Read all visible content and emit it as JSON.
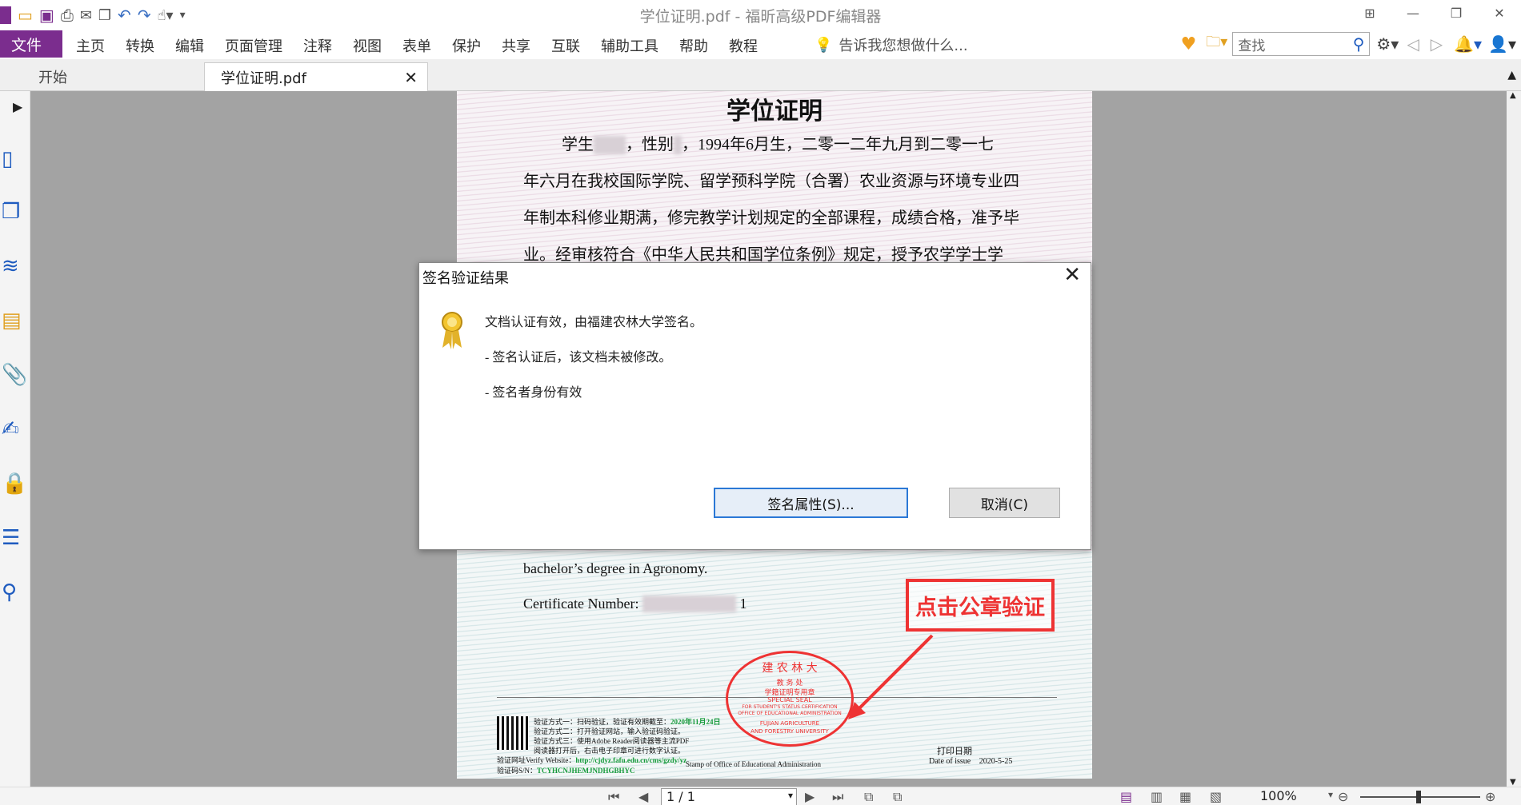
{
  "window": {
    "title": "学位证明.pdf - 福昕高级PDF编辑器"
  },
  "menu": {
    "file": "文件",
    "items": [
      "主页",
      "转换",
      "编辑",
      "页面管理",
      "注释",
      "视图",
      "表单",
      "保护",
      "共享",
      "互联",
      "辅助工具",
      "帮助",
      "教程"
    ],
    "tell_me": "告诉我您想做什么...",
    "search_placeholder": "查找"
  },
  "tabs": [
    {
      "label": "开始"
    },
    {
      "label": "学位证明.pdf"
    }
  ],
  "document": {
    "title": "学位证明",
    "lines": [
      "，性别",
      "，1994年6月生，二零一二年九月到二零一七",
      "年六月在我校国际学院、留学预科学院（合署）农业资源与环境专业四",
      "年制本科修业期满，修完教学计划规定的全部课程，成绩合格，准予毕",
      "业。经审核符合《中华人民共和国学位条例》规定，授予农学学士学"
    ],
    "student_prefix": "学生",
    "english_line": "bachelor’s degree in Agronomy.",
    "cert_label": "Certificate Number:",
    "cert_tail": "1",
    "footer": {
      "v1": "验证方式一：扫码验证，验证有效期截至：",
      "v1_date": "2020年11月24日",
      "v2": "验证方式二：打开验证网站，输入验证码验证。",
      "v3": "验证方式三：使用Adobe Reader阅读器等主流PDF",
      "v3b": "阅读器打开后，右击电子印章可进行数字认证。",
      "site_label": "验证网址Verify Website：",
      "site": "http://cjdyz.fafu.edu.cn/cms/gzdy/yz",
      "sn_label": "验证码S/N：",
      "sn": "TCYHCNJHEMJNDHGBHYC",
      "office": "Stamp of Office of Educational Administration",
      "print_date_label": "打印日期",
      "issue_label": "Date of issue",
      "issue_date": "2020-5-25"
    },
    "seal": {
      "top": "建  农  林  大",
      "mid1": "教  务  处",
      "mid2": "学籍证明专用章",
      "en1": "SPECIAL SEAL",
      "en2": "FOR STUDENT'S STATUS CERTIFICATION",
      "en3": "OFFICE OF EDUCATIONAL ADMINISTRATION",
      "en4": "FUJIAN AGRICULTURE",
      "en5": "AND FORESTRY UNIVERSITY"
    },
    "callout": "点击公章验证"
  },
  "dialog": {
    "title": "签名验证结果",
    "line1": "文档认证有效，由福建农林大学签名。",
    "line2": "- 签名认证后，该文档未被修改。",
    "line3": "- 签名者身份有效",
    "btn_props": "签名属性(S)...",
    "btn_cancel": "取消(C)"
  },
  "status": {
    "page": "1 / 1",
    "zoom": "100%"
  },
  "colors": {
    "brand": "#7b2d8e",
    "accent": "#2b78d6",
    "stamp": "#e33333"
  }
}
